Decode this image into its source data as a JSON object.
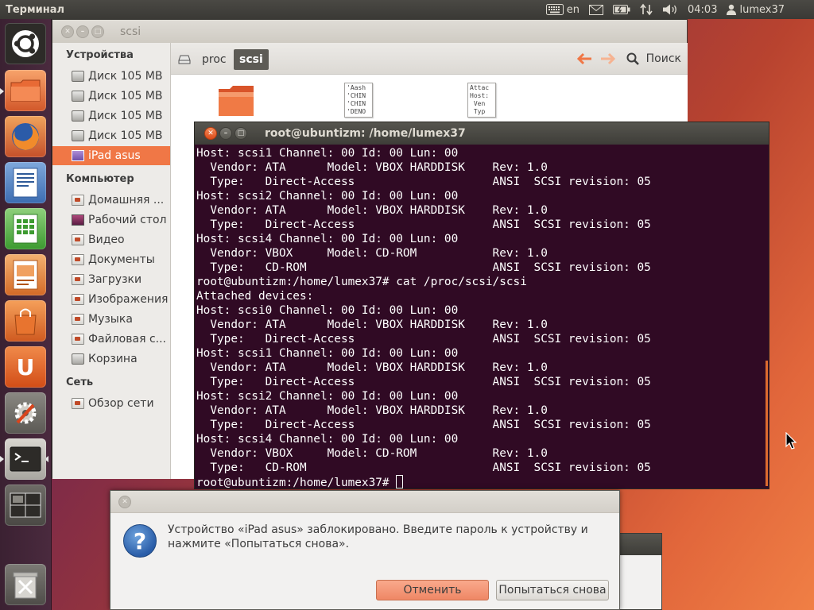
{
  "top_panel": {
    "app_title": "Терминал",
    "keyboard_layout": "en",
    "clock": "04:03",
    "user": "lumex37"
  },
  "launcher": {
    "items": [
      "dash",
      "files",
      "firefox",
      "writer",
      "calc",
      "impress",
      "software-center",
      "ubuntu-one",
      "system-settings",
      "terminal",
      "workspace-switcher",
      "trash"
    ]
  },
  "file_manager": {
    "title": "scsi",
    "sidebar": {
      "devices_header": "Устройства",
      "devices": [
        "Диск 105 MB",
        "Диск 105 MB",
        "Диск 105 MB",
        "Диск 105 MB",
        "iPad asus"
      ],
      "computer_header": "Компьютер",
      "places": [
        "Домашняя ...",
        "Рабочий стол",
        "Видео",
        "Документы",
        "Загрузки",
        "Изображения",
        "Музыка",
        "Файловая с...",
        "Корзина"
      ],
      "network_header": "Сеть",
      "network": [
        "Обзор сети"
      ]
    },
    "breadcrumbs": [
      "proc",
      "scsi"
    ],
    "search_label": "Поиск",
    "files": [
      {
        "preview": "'Aash\n'CHIN\n'CHIN\n'DENO"
      },
      {
        "preview": "Attac\nHost:\n Ven\n Typ"
      }
    ]
  },
  "terminal": {
    "title": "root@ubuntizm: /home/lumex37",
    "lines": [
      "Host: scsi1 Channel: 00 Id: 00 Lun: 00",
      "  Vendor: ATA      Model: VBOX HARDDISK    Rev: 1.0",
      "  Type:   Direct-Access                    ANSI  SCSI revision: 05",
      "Host: scsi2 Channel: 00 Id: 00 Lun: 00",
      "  Vendor: ATA      Model: VBOX HARDDISK    Rev: 1.0",
      "  Type:   Direct-Access                    ANSI  SCSI revision: 05",
      "Host: scsi4 Channel: 00 Id: 00 Lun: 00",
      "  Vendor: VBOX     Model: CD-ROM           Rev: 1.0",
      "  Type:   CD-ROM                           ANSI  SCSI revision: 05",
      "root@ubuntizm:/home/lumex37# cat /proc/scsi/scsi",
      "Attached devices:",
      "Host: scsi0 Channel: 00 Id: 00 Lun: 00",
      "  Vendor: ATA      Model: VBOX HARDDISK    Rev: 1.0",
      "  Type:   Direct-Access                    ANSI  SCSI revision: 05",
      "Host: scsi1 Channel: 00 Id: 00 Lun: 00",
      "  Vendor: ATA      Model: VBOX HARDDISK    Rev: 1.0",
      "  Type:   Direct-Access                    ANSI  SCSI revision: 05",
      "Host: scsi2 Channel: 00 Id: 00 Lun: 00",
      "  Vendor: ATA      Model: VBOX HARDDISK    Rev: 1.0",
      "  Type:   Direct-Access                    ANSI  SCSI revision: 05",
      "Host: scsi4 Channel: 00 Id: 00 Lun: 00",
      "  Vendor: VBOX     Model: CD-ROM           Rev: 1.0",
      "  Type:   CD-ROM                           ANSI  SCSI revision: 05"
    ],
    "prompt": "root@ubuntizm:/home/lumex37# "
  },
  "dialog": {
    "message": "Устройство «iPad asus» заблокировано. Введите пароль к устройству и нажмите «Попытаться снова».",
    "cancel_label": "Отменить",
    "retry_label": "Попытаться снова"
  },
  "colors": {
    "accent": "#f07746",
    "terminal_bg": "#300a24",
    "panel_bg": "#3c3b37"
  }
}
